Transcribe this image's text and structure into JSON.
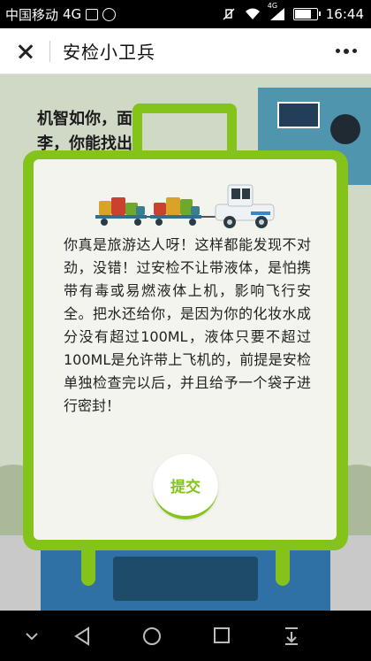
{
  "status_bar": {
    "carrier": "中国移动",
    "network": "4G",
    "network_small": "4G",
    "time": "16:44",
    "icons": [
      "image-icon",
      "emoji-icon",
      "mute-icon",
      "wifi-icon",
      "signal-icon",
      "battery-icon"
    ]
  },
  "header": {
    "title": "安检小卫兵",
    "close_icon": "close-icon",
    "more_icon": "more-icon"
  },
  "background": {
    "question_line1": "机智如你，面",
    "question_line2": "李，你能找出"
  },
  "card": {
    "message": "你真是旅游达人呀！这样都能发现不对劲，没错！过安检不让带液体，是怕携带有毒或易燃液体上机，影响飞行安全。把水还给你，是因为你的化妆水成分没有超过100ML，液体只要不超过100ML是允许带上飞机的，前提是安检单独检查完以后，并且给予一个袋子进行密封！",
    "submit_label": "提交"
  },
  "colors": {
    "accent": "#83c31a",
    "card_bg": "#f3f4ee",
    "scene_bg": "#cfd9c6"
  },
  "nav_bar": {
    "icons": [
      "chevron-down-icon",
      "back-icon",
      "home-icon",
      "recents-icon",
      "download-icon"
    ]
  }
}
